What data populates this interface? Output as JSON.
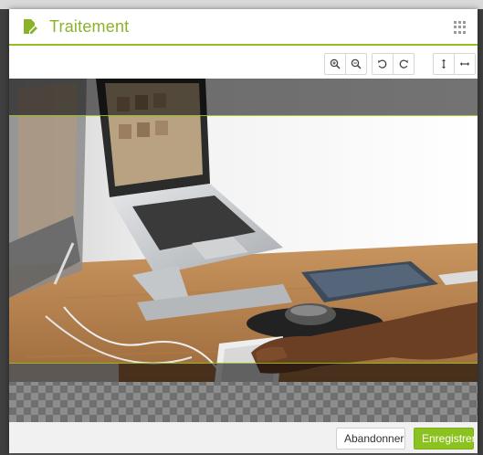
{
  "modal": {
    "title": "Traitement",
    "header_icon": "document-edit-icon",
    "menu_icon": "grid-menu-icon"
  },
  "toolbar": {
    "buttons": [
      {
        "name": "zoom-in-button",
        "icon": "zoom-in-icon"
      },
      {
        "name": "zoom-out-button",
        "icon": "zoom-out-icon"
      },
      {
        "name": "rotate-left-button",
        "icon": "rotate-left-icon"
      },
      {
        "name": "rotate-right-button",
        "icon": "rotate-right-icon"
      },
      {
        "name": "flip-vertical-button",
        "icon": "flip-vertical-icon"
      },
      {
        "name": "flip-horizontal-button",
        "icon": "flip-horizontal-icon"
      }
    ]
  },
  "image": {
    "subject": "person typing at keyboard with laptop on desk"
  },
  "footer": {
    "cancel_label": "Abandonner",
    "save_label": "Enregistrer"
  },
  "colors": {
    "accent": "#93c01f",
    "title": "#8ab329",
    "save_button": "#8cc21f"
  }
}
